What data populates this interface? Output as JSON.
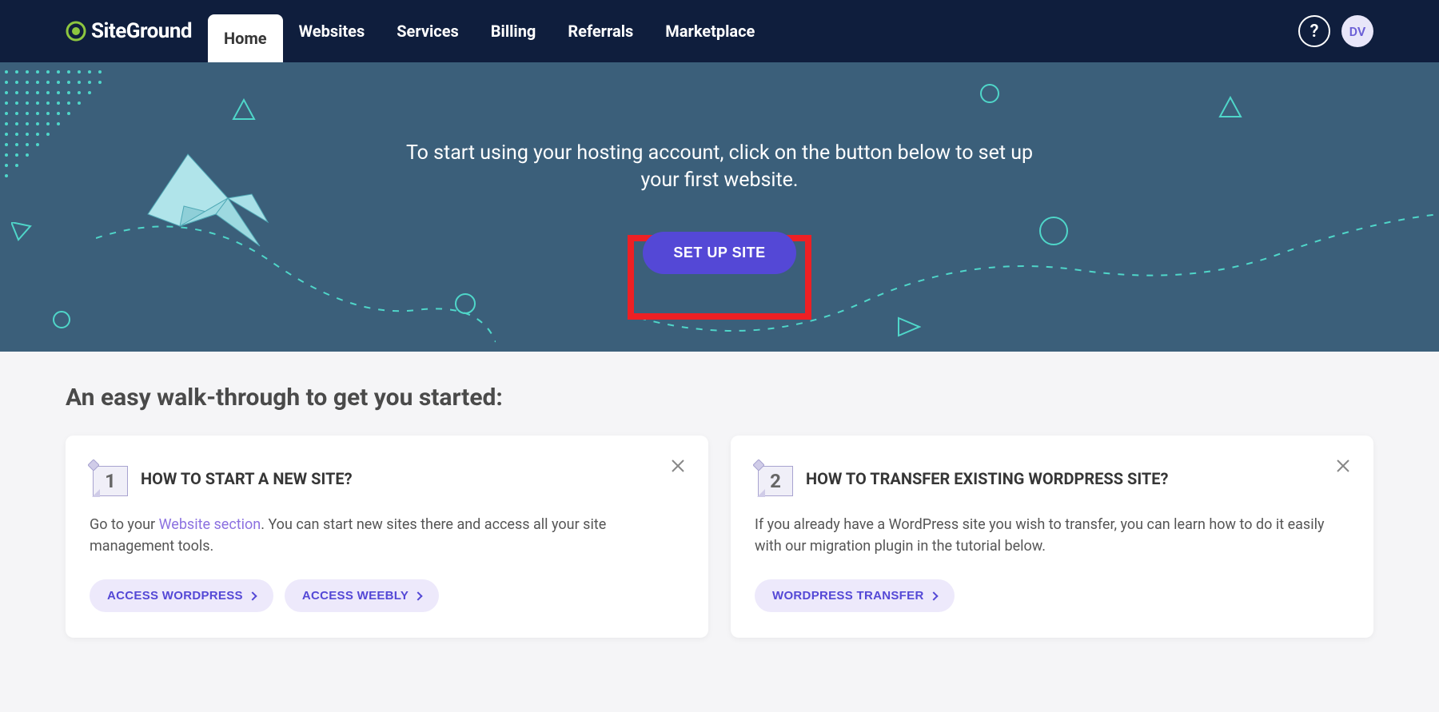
{
  "brand": "SiteGround",
  "nav": {
    "items": [
      {
        "label": "Home",
        "active": true
      },
      {
        "label": "Websites",
        "active": false
      },
      {
        "label": "Services",
        "active": false
      },
      {
        "label": "Billing",
        "active": false
      },
      {
        "label": "Referrals",
        "active": false
      },
      {
        "label": "Marketplace",
        "active": false
      }
    ]
  },
  "user": {
    "initials": "DV"
  },
  "hero": {
    "text": "To start using your hosting account, click on the button below to set up your first website.",
    "cta_label": "SET UP SITE"
  },
  "section": {
    "title": "An easy walk-through to get you started:"
  },
  "cards": [
    {
      "number": "1",
      "title": "HOW TO START A NEW SITE?",
      "desc_pre": "Go to your ",
      "desc_link": "Website section",
      "desc_post": ". You can start new sites there and access all your site management tools.",
      "actions": [
        {
          "label": "ACCESS WORDPRESS"
        },
        {
          "label": "ACCESS WEEBLY"
        }
      ]
    },
    {
      "number": "2",
      "title": "HOW TO TRANSFER EXISTING WORDPRESS SITE?",
      "desc_pre": "If you already have a WordPress site you wish to transfer, you can learn how to do it easily with our migration plugin in the tutorial below.",
      "desc_link": "",
      "desc_post": "",
      "actions": [
        {
          "label": "WORDPRESS TRANSFER"
        }
      ]
    }
  ]
}
